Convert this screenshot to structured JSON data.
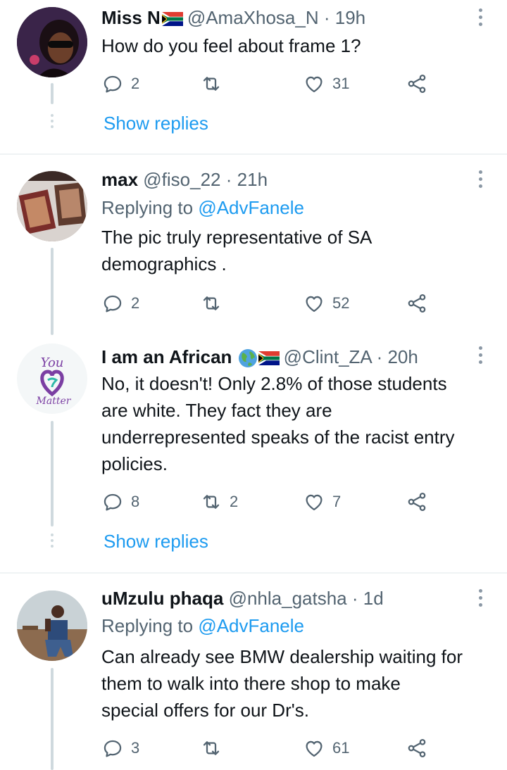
{
  "tweets": [
    {
      "name": "Miss N",
      "handle": "@AmaXhosa_N",
      "separator": "·",
      "time": "19h",
      "text": "How do you feel about frame 1?",
      "replies": "2",
      "retweets": "",
      "likes": "31",
      "show_replies": "Show replies"
    },
    {
      "name": "max",
      "handle": "@fiso_22",
      "separator": "·",
      "time": "21h",
      "replying_prefix": "Replying to",
      "replying_to": "@AdvFanele",
      "text_lines": [
        "The pic truly representative of SA",
        "demographics ."
      ],
      "replies": "2",
      "retweets": "",
      "likes": "52"
    },
    {
      "name": "I am an African",
      "handle": "@Clint_ZA",
      "separator": "·",
      "time": "20h",
      "text_lines": [
        "No, it doesn't! Only 2.8% of those students",
        "are white. They fact they are",
        "underrepresented speaks of the racist entry",
        "policies."
      ],
      "avatar_text": [
        "You",
        "Matter"
      ],
      "replies": "8",
      "retweets": "2",
      "likes": "7",
      "show_replies": "Show replies"
    },
    {
      "name": "uMzulu phaqa",
      "handle": "@nhla_gatsha",
      "separator": "·",
      "time": "1d",
      "replying_prefix": "Replying to",
      "replying_to": "@AdvFanele",
      "text_lines": [
        "Can already see BMW dealership waiting for",
        "them to walk into there shop to make",
        "special offers for our Dr's."
      ],
      "replies": "3",
      "retweets": "",
      "likes": "61"
    }
  ],
  "colors": {
    "link": "#1d9bf0",
    "secondary_text": "#536471",
    "icon": "#536471",
    "thread_line": "#cfd9de",
    "divider": "#eff3f4"
  },
  "icons": [
    "reply-icon",
    "retweet-icon",
    "like-icon",
    "share-icon",
    "more-icon",
    "south-africa-flag-icon",
    "globe-earth-icon"
  ]
}
